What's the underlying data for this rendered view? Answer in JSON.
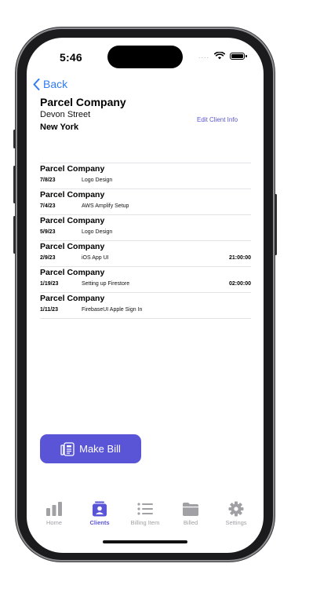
{
  "status_bar": {
    "time": "5:46",
    "dots": "...."
  },
  "nav": {
    "back_label": "Back"
  },
  "client": {
    "name": "Parcel Company",
    "street": "Devon Street",
    "city": "New York",
    "edit_label": "Edit Client Info"
  },
  "billing_items": [
    {
      "client": "Parcel Company",
      "date": "7/8/23",
      "description": "Logo Design",
      "duration": ""
    },
    {
      "client": "Parcel Company",
      "date": "7/4/23",
      "description": "AWS Amplify Setup",
      "duration": ""
    },
    {
      "client": "Parcel Company",
      "date": "5/9/23",
      "description": "Logo Design",
      "duration": ""
    },
    {
      "client": "Parcel Company",
      "date": "2/9/23",
      "description": "iOS App UI",
      "duration": "21:00:00"
    },
    {
      "client": "Parcel Company",
      "date": "1/19/23",
      "description": "Setting up Firestore",
      "duration": "02:00:00"
    },
    {
      "client": "Parcel Company",
      "date": "1/11/23",
      "description": "FirebaseUI Apple Sign In",
      "duration": ""
    }
  ],
  "make_bill": {
    "label": "Make Bill"
  },
  "tabs": [
    {
      "label": "Home",
      "icon": "chart-bar-icon",
      "active": false
    },
    {
      "label": "Clients",
      "icon": "person-card-icon",
      "active": true
    },
    {
      "label": "Billing Item",
      "icon": "list-icon",
      "active": false
    },
    {
      "label": "Billed",
      "icon": "folder-icon",
      "active": false
    },
    {
      "label": "Settings",
      "icon": "gear-icon",
      "active": false
    }
  ],
  "colors": {
    "accent": "#5a55d6",
    "link_blue": "#2f7cf6",
    "inactive_tab": "#a0a0a5"
  }
}
